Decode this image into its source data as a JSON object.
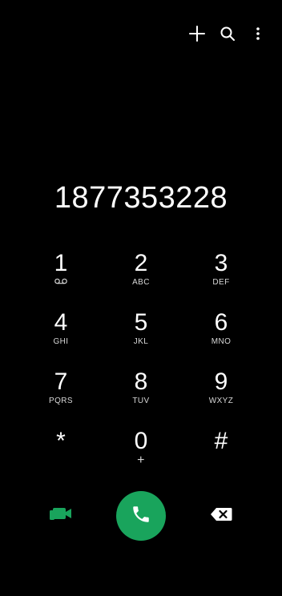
{
  "top_actions": {
    "add_icon": "plus-icon",
    "search_icon": "search-icon",
    "more_icon": "more-vertical-icon"
  },
  "dialed_number": "1877353228",
  "keypad": {
    "keys": [
      {
        "digit": "1",
        "sub": ""
      },
      {
        "digit": "2",
        "sub": "ABC"
      },
      {
        "digit": "3",
        "sub": "DEF"
      },
      {
        "digit": "4",
        "sub": "GHI"
      },
      {
        "digit": "5",
        "sub": "JKL"
      },
      {
        "digit": "6",
        "sub": "MNO"
      },
      {
        "digit": "7",
        "sub": "PQRS"
      },
      {
        "digit": "8",
        "sub": "TUV"
      },
      {
        "digit": "9",
        "sub": "WXYZ"
      },
      {
        "digit": "*",
        "sub": ""
      },
      {
        "digit": "0",
        "sub": "+"
      },
      {
        "digit": "#",
        "sub": ""
      }
    ]
  },
  "bottom": {
    "video_icon": "video-call-icon",
    "call_icon": "phone-icon",
    "backspace_icon": "backspace-icon"
  },
  "colors": {
    "background": "#000000",
    "accent_green": "#19a45c",
    "text": "#ffffff"
  }
}
